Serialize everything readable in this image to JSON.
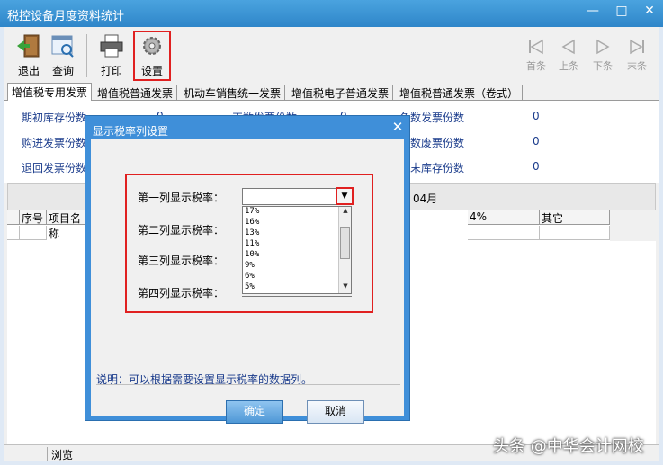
{
  "window": {
    "title": "税控设备月度资料统计",
    "min": "—",
    "max": "□",
    "close": "✕"
  },
  "toolbar": {
    "exit": "退出",
    "query": "查询",
    "print": "打印",
    "settings": "设置",
    "first": "首条",
    "prev": "上条",
    "next": "下条",
    "last": "末条"
  },
  "tabs": [
    "增值税专用发票",
    "增值税普通发票",
    "机动车销售统一发票",
    "增值税电子普通发票",
    "增值税普通发票（卷式）"
  ],
  "summary": {
    "opening_stock": "期初库存份数",
    "opening_stock_value": "0",
    "purchased": "购进发票份数",
    "returned": "退回发票份数",
    "normal_issued": "正数发票份数",
    "normal_issued_value": "0",
    "negative_count": "负数发票份数",
    "negative_count_value": "0",
    "negative_void": "负数废票份数",
    "negative_void_value": "0",
    "closing_stock": "期末库存份数",
    "closing_stock_value": "0"
  },
  "month_label": "04月",
  "grid": {
    "col_seq": "序号",
    "col_item": "项目名称",
    "col_4pct": "4%",
    "col_other": "其它"
  },
  "statusbar": {
    "mode": "浏览"
  },
  "dialog": {
    "title": "显示税率列设置",
    "close": "✕",
    "row1": "第一列显示税率：",
    "row2": "第二列显示税率：",
    "row3": "第三列显示税率：",
    "row4": "第四列显示税率：",
    "combo1_value": "",
    "options": [
      "17%",
      "16%",
      "13%",
      "11%",
      "10%",
      "9%",
      "6%",
      "5%"
    ],
    "note": "说明：可以根据需要设置显示税率的数据列。",
    "ok": "确定",
    "cancel": "取消"
  },
  "watermark": "头条 @中华会计网校"
}
